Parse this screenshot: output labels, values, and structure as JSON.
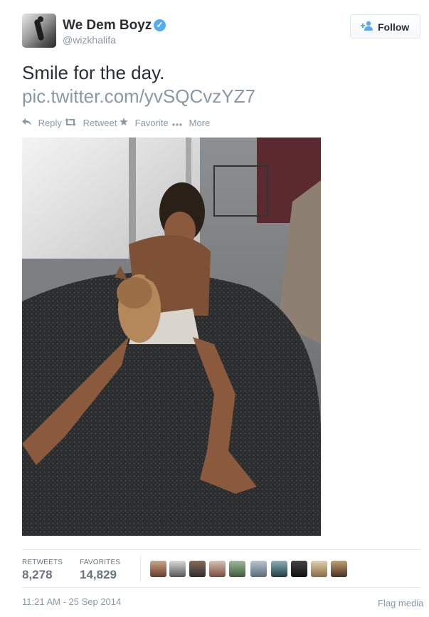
{
  "user": {
    "name": "We Dem Boyz",
    "handle": "@wizkhalifa",
    "verified_glyph": "✓"
  },
  "follow_button": {
    "label": "Follow",
    "icon": "add-user-icon"
  },
  "tweet": {
    "text": "Smile for the day.",
    "link": "pic.twitter.com/yvSQCvzYZ7"
  },
  "actions": {
    "reply": {
      "label": "Reply",
      "icon": "reply-icon"
    },
    "retweet": {
      "label": "Retweet",
      "icon": "retweet-icon"
    },
    "favorite": {
      "label": "Favorite",
      "icon": "star-icon"
    },
    "more": {
      "label": "More",
      "icon": "more-dots-icon"
    }
  },
  "stats": {
    "retweets_label": "RETWEETS",
    "retweets": "8,278",
    "favorites_label": "FAVORITES",
    "favorites": "14,829",
    "favoriter_avatar_count": 10
  },
  "footer": {
    "timestamp": "11:21 AM - 25 Sep 2014",
    "flag": "Flag media"
  },
  "colors": {
    "text": "#292f33",
    "muted": "#8899a6",
    "verified": "#55acee",
    "border": "#e1e8ed"
  }
}
